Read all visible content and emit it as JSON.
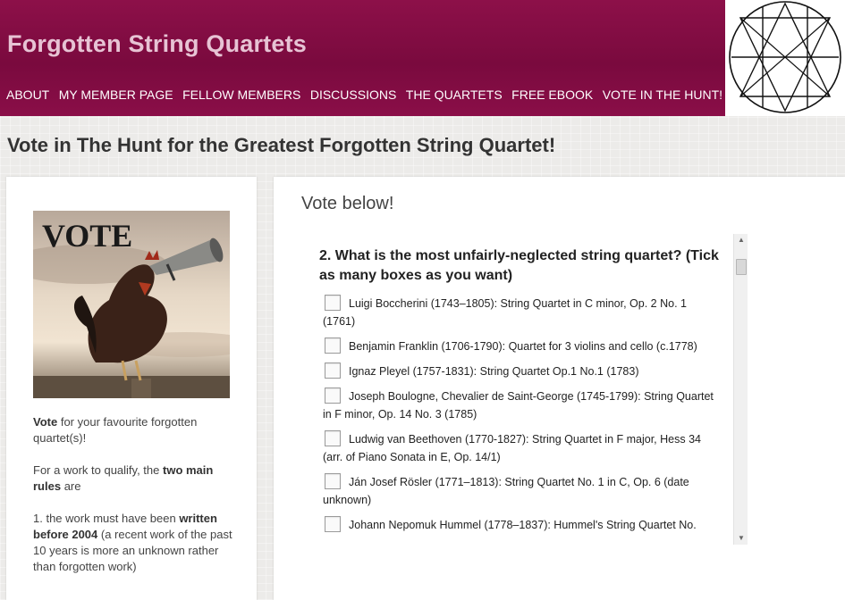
{
  "header": {
    "site_title": "Forgotten String Quartets",
    "nav": [
      "ABOUT",
      "MY MEMBER PAGE",
      "FELLOW MEMBERS",
      "DISCUSSIONS",
      "THE QUARTETS",
      "FREE EBOOK",
      "VOTE IN THE HUNT!"
    ]
  },
  "page": {
    "title": "Vote in The Hunt for the Greatest Forgotten String Quartet!"
  },
  "sidebar": {
    "image_caption": "VOTE",
    "p1_bold": "Vote",
    "p1_rest": " for your favourite forgotten quartet(s)!",
    "p2_start": "For a work to qualify, the ",
    "p2_bold": "two main rules",
    "p2_end": " are",
    "p3_start": "1. the work must have been ",
    "p3_bold": "written before 2004",
    "p3_end": " (a recent work of the past 10 years is more an unknown rather than forgotten work)"
  },
  "main": {
    "vote_below": "Vote below!",
    "question": "2. What is the most unfairly-neglected string quartet? (Tick as many boxes as you want)",
    "options": [
      "Luigi Boccherini (1743–1805): String Quartet in C minor, Op. 2 No. 1 (1761)",
      "Benjamin Franklin (1706-1790): Quartet for 3 violins and cello (c.1778)",
      "Ignaz Pleyel (1757-1831): String Quartet Op.1 No.1 (1783)",
      "Joseph Boulogne, Chevalier de Saint-George (1745-1799): String Quartet in F minor, Op. 14 No. 3 (1785)",
      "Ludwig van Beethoven (1770-1827): String Quartet in F major, Hess 34 (arr. of Piano Sonata in E, Op. 14/1)",
      "Ján Josef Rösler (1771–1813): String Quartet No. 1 in C, Op. 6 (date unknown)",
      "Johann Nepomuk Hummel (1778–1837): Hummel's String Quartet No."
    ]
  },
  "colors": {
    "header_bg": "#7a0a3e",
    "title_text": "#e7c3d4"
  }
}
